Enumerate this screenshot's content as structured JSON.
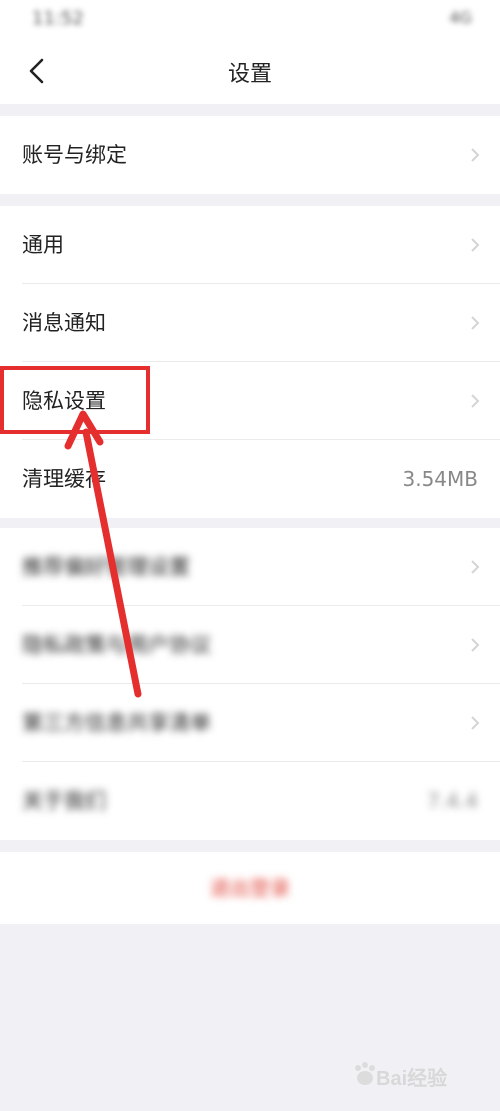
{
  "status_bar": {
    "time": "11:52",
    "right": "4G"
  },
  "header": {
    "title": "设置"
  },
  "groups": [
    {
      "items": [
        {
          "label": "账号与绑定"
        }
      ]
    },
    {
      "items": [
        {
          "label": "通用"
        },
        {
          "label": "消息通知"
        },
        {
          "label": "隐私设置"
        },
        {
          "label": "清理缓存",
          "value": "3.54MB"
        }
      ]
    },
    {
      "items": [
        {
          "label": "推荐偏好管理设置"
        },
        {
          "label": "隐私政策与用户协议"
        },
        {
          "label": "第三方信息共享清单"
        },
        {
          "label": "关于我们",
          "value": "7.4.4"
        }
      ]
    }
  ],
  "logout_label": "退出登录",
  "watermark": "Bai经验",
  "colors": {
    "background": "#f1f0f5",
    "annotation": "#e52e2e",
    "logout": "#e0453a"
  }
}
